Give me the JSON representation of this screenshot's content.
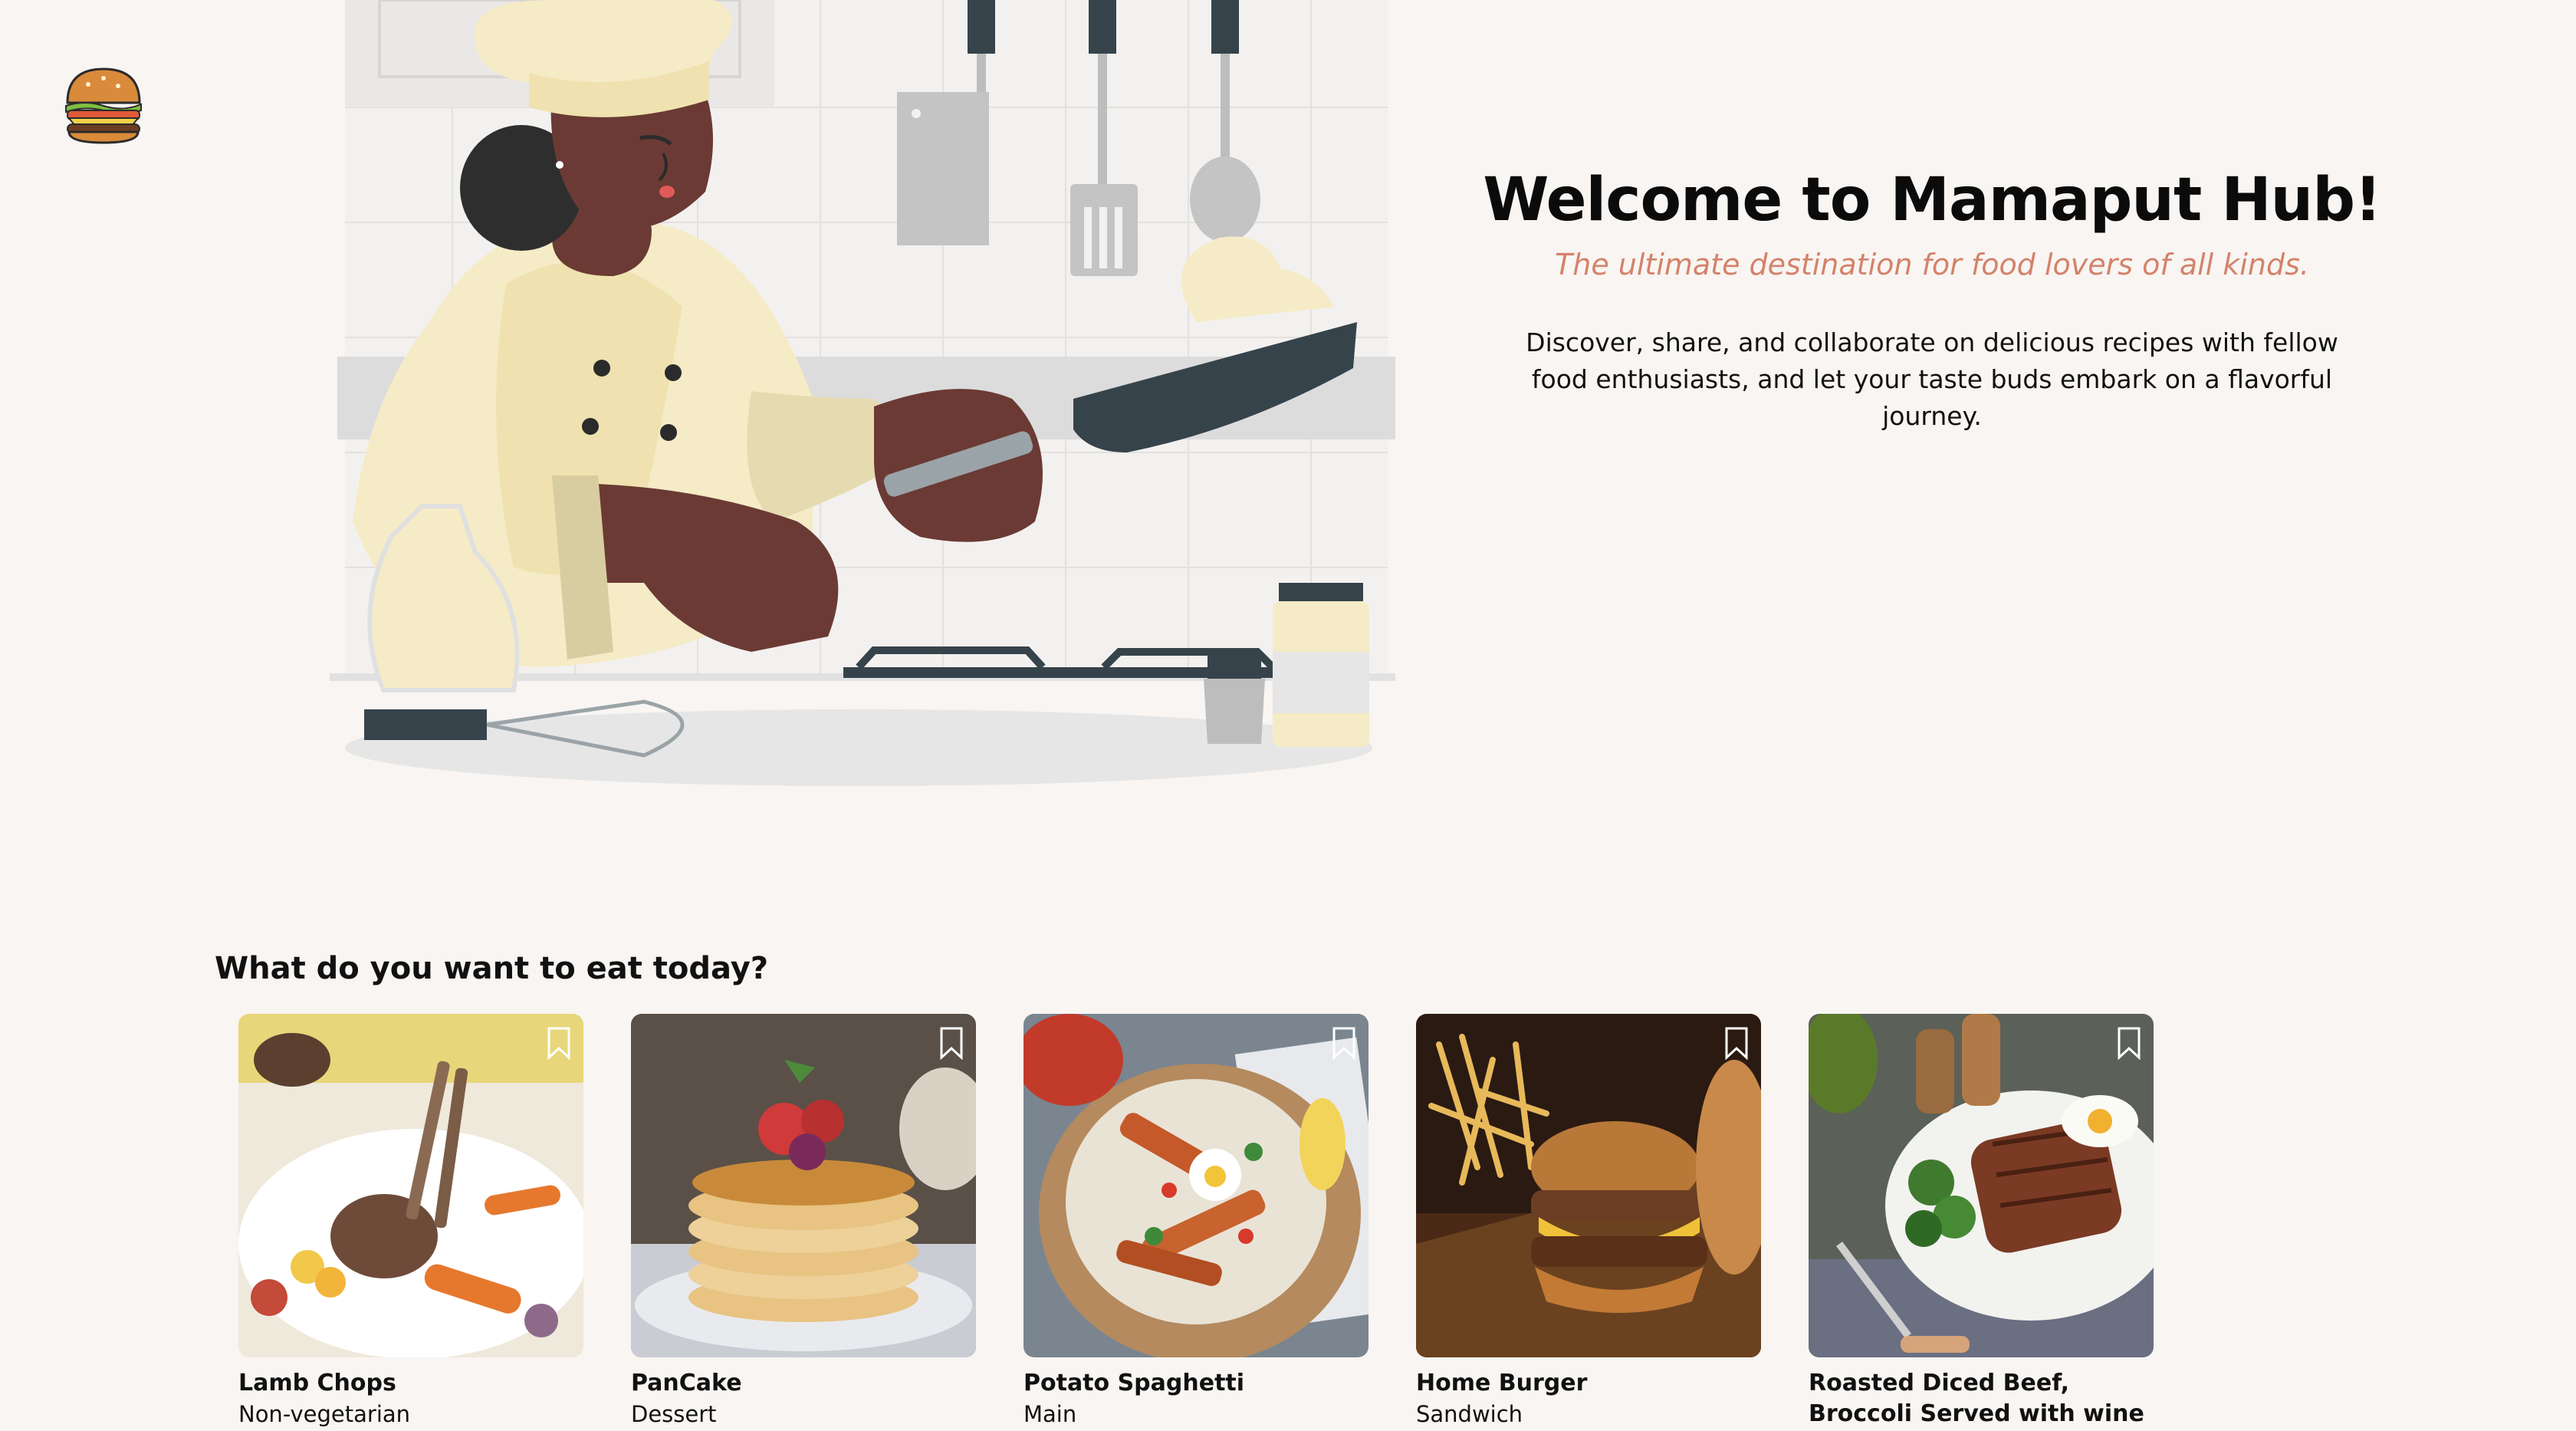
{
  "brand": {
    "logo_icon": "burger-icon"
  },
  "hero": {
    "illustration": "chef-cooking-illustration",
    "title": "Welcome to Mamaput Hub!",
    "tagline": "The ultimate destination for food lovers of all kinds.",
    "description": "Discover, share, and collaborate on delicious recipes with fellow food enthusiasts, and let your taste buds embark on a flavorful journey."
  },
  "recipes": {
    "heading": "What do you want to eat today?",
    "bookmark_icon": "bookmark-icon",
    "items": [
      {
        "title": "Lamb Chops",
        "category": "Non-vegetarian"
      },
      {
        "title": "PanCake",
        "category": "Dessert"
      },
      {
        "title": "Potato Spaghetti",
        "category": "Main"
      },
      {
        "title": "Home Burger",
        "category": "Sandwich"
      },
      {
        "title": "Roasted Diced Beef, Broccoli Served with wine",
        "category": ""
      }
    ]
  },
  "colors": {
    "background": "#f8f5f2",
    "accent": "#d4826a",
    "chef_coat": "#f5ebc6",
    "skin": "#6b3a34",
    "dark": "#36434b"
  }
}
